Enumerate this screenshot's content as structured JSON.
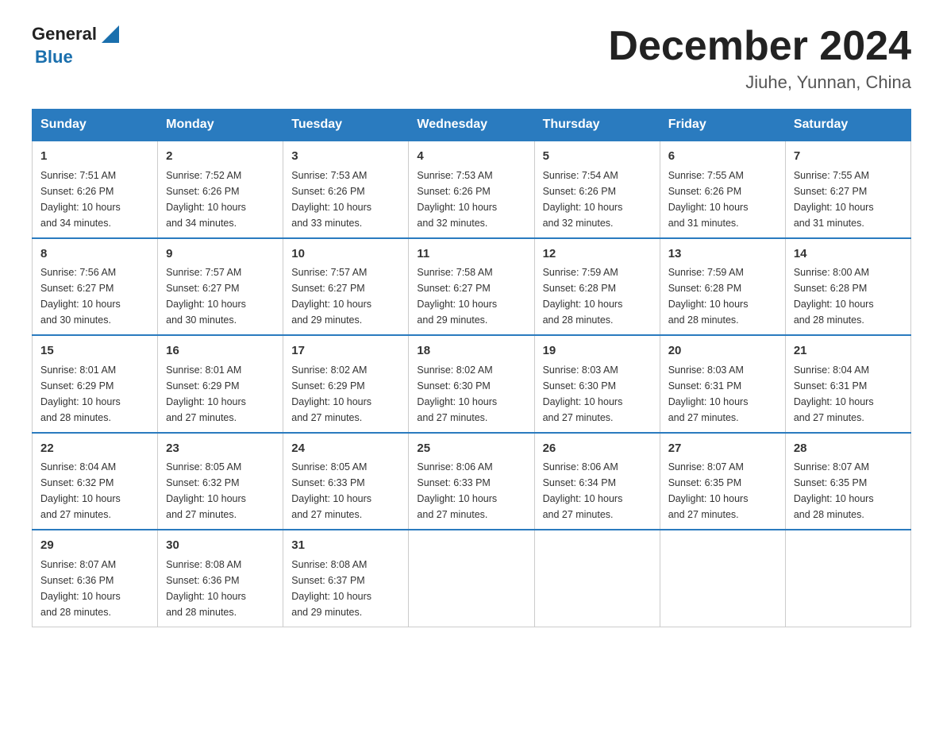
{
  "logo": {
    "text_general": "General",
    "text_blue": "Blue",
    "arrow": "▲"
  },
  "header": {
    "title": "December 2024",
    "subtitle": "Jiuhe, Yunnan, China"
  },
  "weekdays": [
    "Sunday",
    "Monday",
    "Tuesday",
    "Wednesday",
    "Thursday",
    "Friday",
    "Saturday"
  ],
  "weeks": [
    [
      {
        "day": "1",
        "info": "Sunrise: 7:51 AM\nSunset: 6:26 PM\nDaylight: 10 hours\nand 34 minutes."
      },
      {
        "day": "2",
        "info": "Sunrise: 7:52 AM\nSunset: 6:26 PM\nDaylight: 10 hours\nand 34 minutes."
      },
      {
        "day": "3",
        "info": "Sunrise: 7:53 AM\nSunset: 6:26 PM\nDaylight: 10 hours\nand 33 minutes."
      },
      {
        "day": "4",
        "info": "Sunrise: 7:53 AM\nSunset: 6:26 PM\nDaylight: 10 hours\nand 32 minutes."
      },
      {
        "day": "5",
        "info": "Sunrise: 7:54 AM\nSunset: 6:26 PM\nDaylight: 10 hours\nand 32 minutes."
      },
      {
        "day": "6",
        "info": "Sunrise: 7:55 AM\nSunset: 6:26 PM\nDaylight: 10 hours\nand 31 minutes."
      },
      {
        "day": "7",
        "info": "Sunrise: 7:55 AM\nSunset: 6:27 PM\nDaylight: 10 hours\nand 31 minutes."
      }
    ],
    [
      {
        "day": "8",
        "info": "Sunrise: 7:56 AM\nSunset: 6:27 PM\nDaylight: 10 hours\nand 30 minutes."
      },
      {
        "day": "9",
        "info": "Sunrise: 7:57 AM\nSunset: 6:27 PM\nDaylight: 10 hours\nand 30 minutes."
      },
      {
        "day": "10",
        "info": "Sunrise: 7:57 AM\nSunset: 6:27 PM\nDaylight: 10 hours\nand 29 minutes."
      },
      {
        "day": "11",
        "info": "Sunrise: 7:58 AM\nSunset: 6:27 PM\nDaylight: 10 hours\nand 29 minutes."
      },
      {
        "day": "12",
        "info": "Sunrise: 7:59 AM\nSunset: 6:28 PM\nDaylight: 10 hours\nand 28 minutes."
      },
      {
        "day": "13",
        "info": "Sunrise: 7:59 AM\nSunset: 6:28 PM\nDaylight: 10 hours\nand 28 minutes."
      },
      {
        "day": "14",
        "info": "Sunrise: 8:00 AM\nSunset: 6:28 PM\nDaylight: 10 hours\nand 28 minutes."
      }
    ],
    [
      {
        "day": "15",
        "info": "Sunrise: 8:01 AM\nSunset: 6:29 PM\nDaylight: 10 hours\nand 28 minutes."
      },
      {
        "day": "16",
        "info": "Sunrise: 8:01 AM\nSunset: 6:29 PM\nDaylight: 10 hours\nand 27 minutes."
      },
      {
        "day": "17",
        "info": "Sunrise: 8:02 AM\nSunset: 6:29 PM\nDaylight: 10 hours\nand 27 minutes."
      },
      {
        "day": "18",
        "info": "Sunrise: 8:02 AM\nSunset: 6:30 PM\nDaylight: 10 hours\nand 27 minutes."
      },
      {
        "day": "19",
        "info": "Sunrise: 8:03 AM\nSunset: 6:30 PM\nDaylight: 10 hours\nand 27 minutes."
      },
      {
        "day": "20",
        "info": "Sunrise: 8:03 AM\nSunset: 6:31 PM\nDaylight: 10 hours\nand 27 minutes."
      },
      {
        "day": "21",
        "info": "Sunrise: 8:04 AM\nSunset: 6:31 PM\nDaylight: 10 hours\nand 27 minutes."
      }
    ],
    [
      {
        "day": "22",
        "info": "Sunrise: 8:04 AM\nSunset: 6:32 PM\nDaylight: 10 hours\nand 27 minutes."
      },
      {
        "day": "23",
        "info": "Sunrise: 8:05 AM\nSunset: 6:32 PM\nDaylight: 10 hours\nand 27 minutes."
      },
      {
        "day": "24",
        "info": "Sunrise: 8:05 AM\nSunset: 6:33 PM\nDaylight: 10 hours\nand 27 minutes."
      },
      {
        "day": "25",
        "info": "Sunrise: 8:06 AM\nSunset: 6:33 PM\nDaylight: 10 hours\nand 27 minutes."
      },
      {
        "day": "26",
        "info": "Sunrise: 8:06 AM\nSunset: 6:34 PM\nDaylight: 10 hours\nand 27 minutes."
      },
      {
        "day": "27",
        "info": "Sunrise: 8:07 AM\nSunset: 6:35 PM\nDaylight: 10 hours\nand 27 minutes."
      },
      {
        "day": "28",
        "info": "Sunrise: 8:07 AM\nSunset: 6:35 PM\nDaylight: 10 hours\nand 28 minutes."
      }
    ],
    [
      {
        "day": "29",
        "info": "Sunrise: 8:07 AM\nSunset: 6:36 PM\nDaylight: 10 hours\nand 28 minutes."
      },
      {
        "day": "30",
        "info": "Sunrise: 8:08 AM\nSunset: 6:36 PM\nDaylight: 10 hours\nand 28 minutes."
      },
      {
        "day": "31",
        "info": "Sunrise: 8:08 AM\nSunset: 6:37 PM\nDaylight: 10 hours\nand 29 minutes."
      },
      {
        "day": "",
        "info": ""
      },
      {
        "day": "",
        "info": ""
      },
      {
        "day": "",
        "info": ""
      },
      {
        "day": "",
        "info": ""
      }
    ]
  ]
}
